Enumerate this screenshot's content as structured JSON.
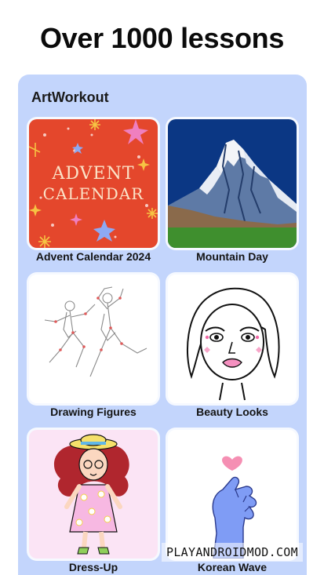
{
  "headline": "Over 1000 lessons",
  "app_name": "ArtWorkout",
  "lessons": [
    {
      "title": "Advent Calendar 2024",
      "thumb_text_line1": "ADVENT",
      "thumb_text_line2": "CALENDAR"
    },
    {
      "title": "Mountain Day"
    },
    {
      "title": "Drawing Figures"
    },
    {
      "title": "Beauty Looks"
    },
    {
      "title": "Dress-Up"
    },
    {
      "title": "Korean Wave"
    }
  ],
  "watermark": "PLAYANDROIDMOD.COM",
  "colors": {
    "panel_bg": "#c3d5fc",
    "advent_bg": "#e4472c",
    "mountain_sky": "#0b3784",
    "dressup_bg": "#fbe4f5"
  }
}
